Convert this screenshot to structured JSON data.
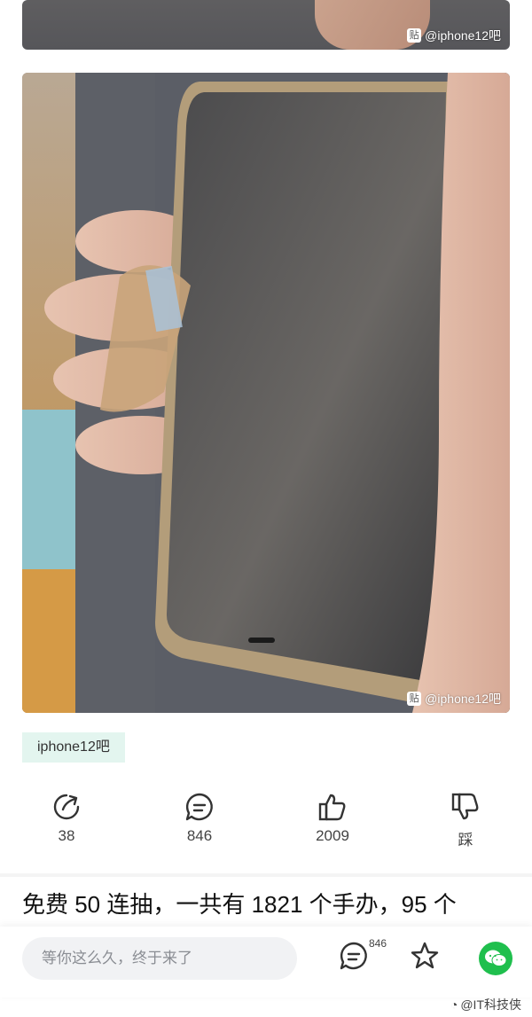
{
  "post": {
    "top_image_watermark": "@iphone12吧",
    "main_image_watermark": "@iphone12吧",
    "watermark_badge": "贴",
    "forum_tag": "iphone12吧",
    "actions": [
      {
        "name": "share",
        "icon": "share-icon",
        "count": "38"
      },
      {
        "name": "comment",
        "icon": "comment-icon",
        "count": "846"
      },
      {
        "name": "like",
        "icon": "thumbs-up-icon",
        "count": "2009"
      },
      {
        "name": "dislike",
        "icon": "thumbs-down-icon",
        "count": "踩"
      }
    ],
    "next_post_title": "免费 50 连抽，一共有 1821 个手办，95 个"
  },
  "bottom_bar": {
    "input_placeholder": "等你这么久，终于来了",
    "comment_count": "846",
    "icons": [
      "comment-icon",
      "star-icon",
      "wechat-icon"
    ]
  },
  "credit": "@IT科技侠",
  "colors": {
    "accent": "#1fbf4d",
    "tag_bg": "#e3f5ef"
  }
}
